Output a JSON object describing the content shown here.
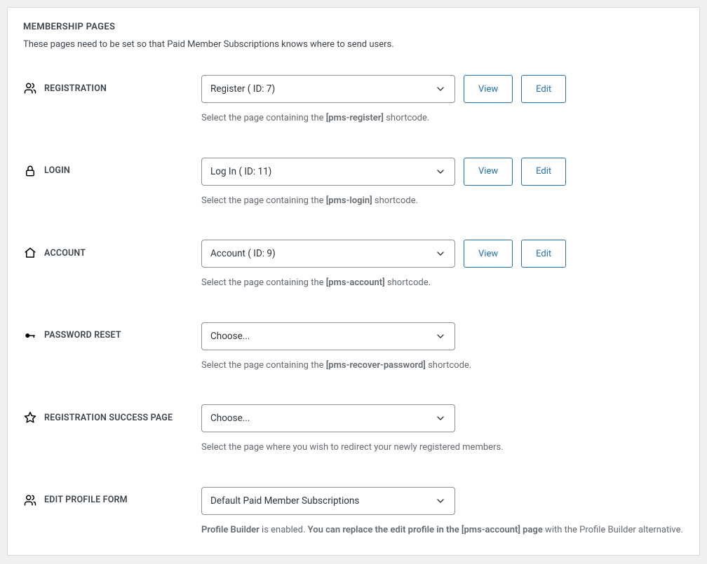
{
  "panel": {
    "title": "MEMBERSHIP PAGES",
    "description": "These pages need to be set so that Paid Member Subscriptions knows where to send users."
  },
  "buttons": {
    "view": "View",
    "edit": "Edit"
  },
  "rows": {
    "registration": {
      "label": "REGISTRATION",
      "select_value": "Register ( ID: 7)",
      "helper_prefix": "Select the page containing the ",
      "helper_code": "[pms-register]",
      "helper_suffix": " shortcode."
    },
    "login": {
      "label": "LOGIN",
      "select_value": "Log In ( ID: 11)",
      "helper_prefix": "Select the page containing the ",
      "helper_code": "[pms-login]",
      "helper_suffix": " shortcode."
    },
    "account": {
      "label": "ACCOUNT",
      "select_value": "Account ( ID: 9)",
      "helper_prefix": "Select the page containing the ",
      "helper_code": "[pms-account]",
      "helper_suffix": " shortcode."
    },
    "password_reset": {
      "label": "PASSWORD RESET",
      "select_value": "Choose...",
      "helper_prefix": "Select the page containing the ",
      "helper_code": "[pms-recover-password]",
      "helper_suffix": " shortcode."
    },
    "reg_success": {
      "label": "REGISTRATION SUCCESS PAGE",
      "select_value": "Choose...",
      "helper": "Select the page where you wish to redirect your newly registered members."
    },
    "edit_profile": {
      "label": "EDIT PROFILE FORM",
      "select_value": "Default Paid Member Subscriptions",
      "helper_bold1": "Profile Builder",
      "helper_mid": " is enabled. ",
      "helper_bold2": "You can replace the edit profile in the [pms-account] page",
      "helper_end": " with the Profile Builder alternative."
    }
  }
}
